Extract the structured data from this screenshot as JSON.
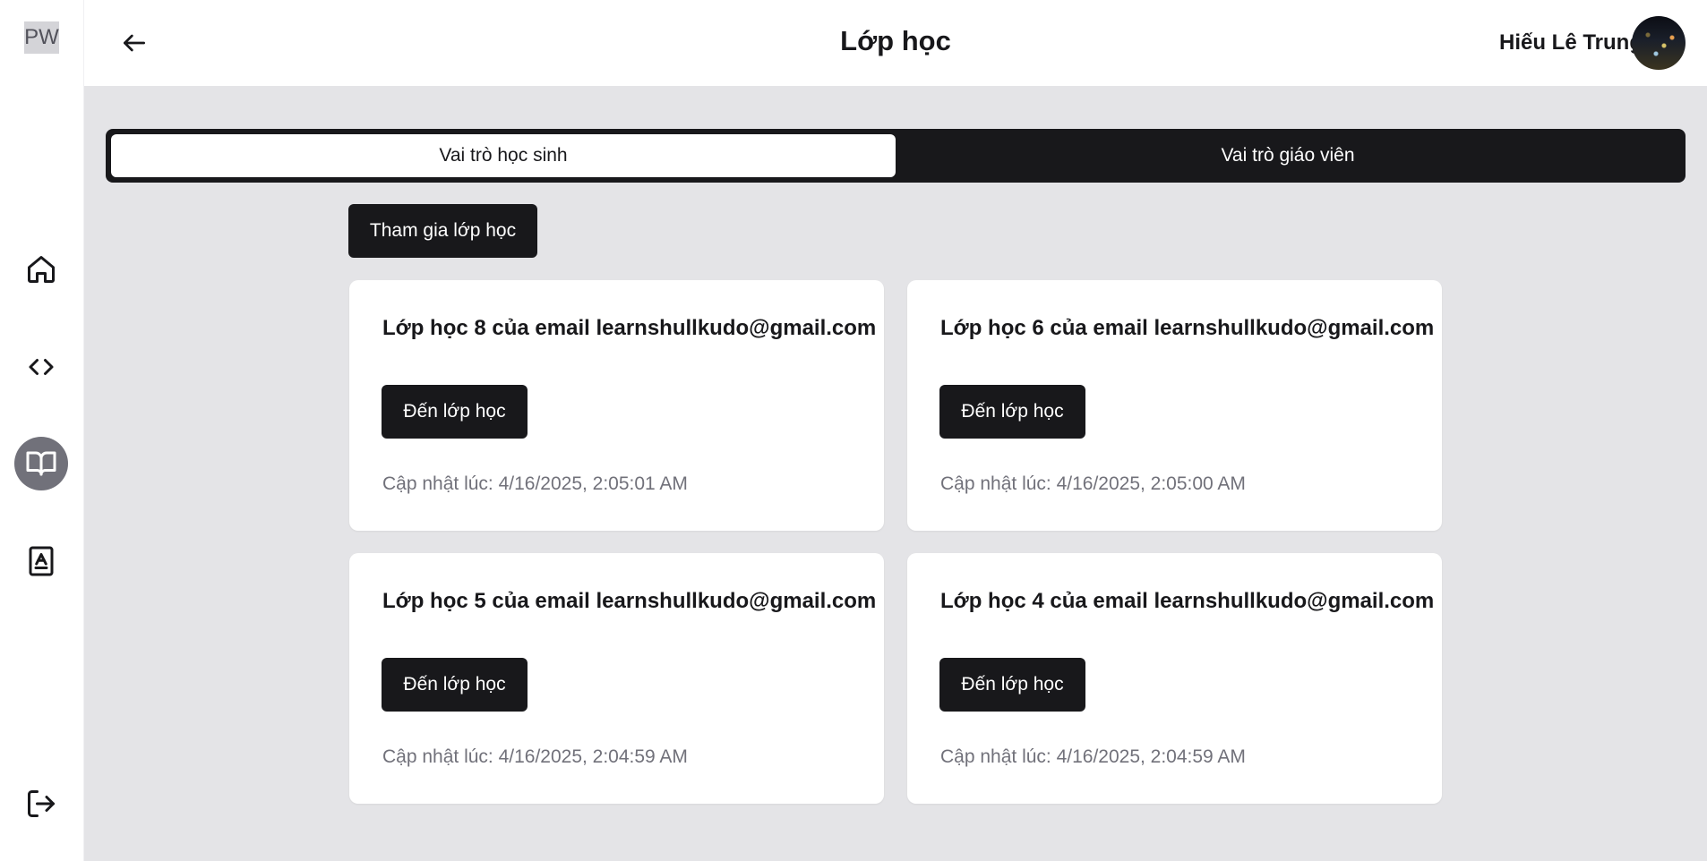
{
  "sidebar": {
    "logo": "PW",
    "items": [
      {
        "icon": "home-icon",
        "active": false
      },
      {
        "icon": "code-icon",
        "active": false
      },
      {
        "icon": "book-open-icon",
        "active": true
      },
      {
        "icon": "contact-book-icon",
        "active": false
      }
    ],
    "logout_icon": "logout-icon"
  },
  "header": {
    "back_icon": "arrow-left-icon",
    "title": "Lớp học",
    "user_name": "Hiếu Lê Trung"
  },
  "tabs": [
    {
      "label": "Vai trò học sinh",
      "active": true
    },
    {
      "label": "Vai trò giáo viên",
      "active": false
    }
  ],
  "join_button": "Tham gia lớp học",
  "classes": [
    {
      "title": "Lớp học 8 của email learnshullkudo@gmail.com",
      "button": "Đến lớp học",
      "updated": "Cập nhật lúc: 4/16/2025, 2:05:01 AM"
    },
    {
      "title": "Lớp học 6 của email learnshullkudo@gmail.com",
      "button": "Đến lớp học",
      "updated": "Cập nhật lúc: 4/16/2025, 2:05:00 AM"
    },
    {
      "title": "Lớp học 5 của email learnshullkudo@gmail.com",
      "button": "Đến lớp học",
      "updated": "Cập nhật lúc: 4/16/2025, 2:04:59 AM"
    },
    {
      "title": "Lớp học 4 của email learnshullkudo@gmail.com",
      "button": "Đến lớp học",
      "updated": "Cập nhật lúc: 4/16/2025, 2:04:59 AM"
    }
  ],
  "colors": {
    "primary": "#18181b",
    "background": "#e4e4e7",
    "muted_text": "#71717a",
    "active_nav": "#71717a"
  }
}
